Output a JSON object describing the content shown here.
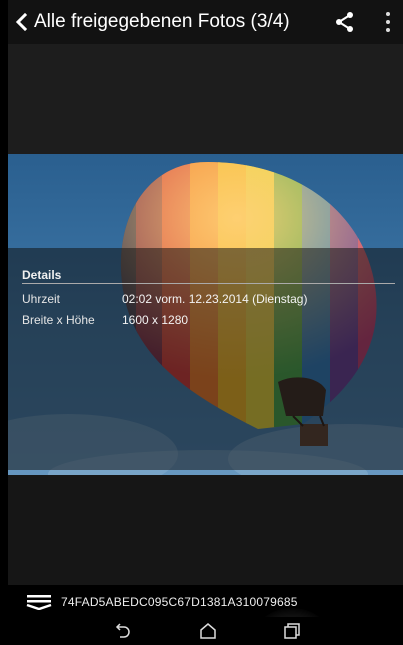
{
  "action_bar": {
    "back_icon": "chevron-left-icon",
    "title": "Alle freigegebenen Fotos (3/4)",
    "share_icon": "share-icon",
    "menu_icon": "overflow-menu-icon"
  },
  "photo": {
    "subject": "hot-air-balloon"
  },
  "details": {
    "heading": "Details",
    "rows": [
      {
        "label": "Uhrzeit",
        "value": "02:02 vorm. 12.23.2014 (Dienstag)"
      },
      {
        "label": "Breite x Höhe",
        "value": "1600 x 1280"
      }
    ]
  },
  "bottom_strip": {
    "icon": "layers-icon",
    "text": "74FAD5ABEDC095C67D1381A310079685"
  },
  "nav_bar": {
    "back_icon": "back-icon",
    "home_icon": "home-icon",
    "recents_icon": "recents-icon"
  },
  "colors": {
    "sky": "#3f78a8",
    "overlay": "#0f0f0f",
    "bar": "#121212"
  }
}
